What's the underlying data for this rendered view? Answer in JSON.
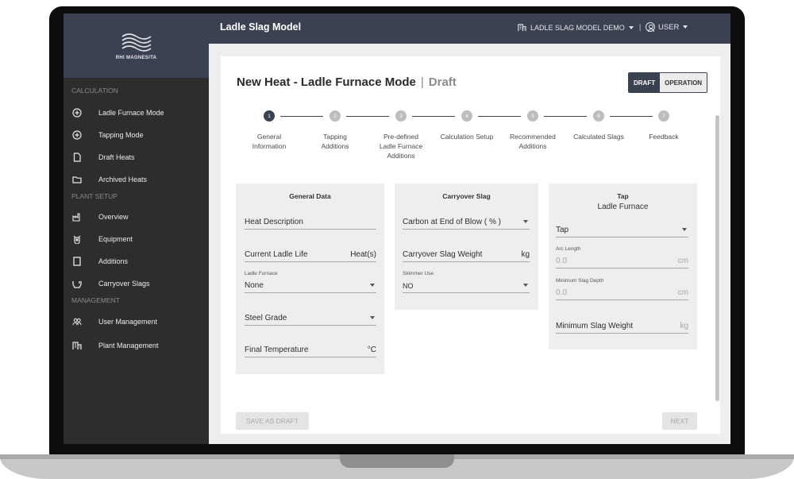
{
  "brand": {
    "name": "RHI MAGNESITA"
  },
  "header": {
    "app_title": "Ladle Slag Model",
    "tenant": "LADLE SLAG MODEL DEMO",
    "separator": "|",
    "user": "USER"
  },
  "sidebar": {
    "sections": [
      {
        "label": "CALCULATION",
        "items": [
          {
            "label": "Ladle Furnace Mode",
            "icon": "plus-circle-icon"
          },
          {
            "label": "Tapping Mode",
            "icon": "plus-circle-icon"
          },
          {
            "label": "Draft Heats",
            "icon": "file-icon"
          },
          {
            "label": "Archived Heats",
            "icon": "folder-icon"
          }
        ]
      },
      {
        "label": "PLANT SETUP",
        "items": [
          {
            "label": "Overview",
            "icon": "factory-icon"
          },
          {
            "label": "Equipment",
            "icon": "equipment-icon"
          },
          {
            "label": "Additions",
            "icon": "square-icon"
          },
          {
            "label": "Carryover Slags",
            "icon": "ladle-icon"
          }
        ]
      },
      {
        "label": "MANAGEMENT",
        "items": [
          {
            "label": "User Management",
            "icon": "users-icon"
          },
          {
            "label": "Plant Management",
            "icon": "building-icon"
          }
        ]
      }
    ]
  },
  "page": {
    "title": "New Heat - Ladle Furnace Mode",
    "separator": "|",
    "status": "Draft",
    "mode_toggle": {
      "draft": "DRAFT",
      "operation": "OPERATION",
      "active": "draft"
    }
  },
  "stepper": {
    "current": 1,
    "steps": [
      {
        "number": "1",
        "label_lines": [
          "General",
          "Information"
        ]
      },
      {
        "number": "2",
        "label_lines": [
          "Tapping",
          "Additions"
        ]
      },
      {
        "number": "3",
        "label_lines": [
          "Pre-defined",
          "Ladle Furnace",
          "Additions"
        ]
      },
      {
        "number": "4",
        "label_lines": [
          "Calculation Setup"
        ]
      },
      {
        "number": "5",
        "label_lines": [
          "Recommended",
          "Additions"
        ]
      },
      {
        "number": "6",
        "label_lines": [
          "Calculated Slags"
        ]
      },
      {
        "number": "7",
        "label_lines": [
          "Feedback"
        ]
      }
    ]
  },
  "general_data": {
    "title": "General Data",
    "heat_description": {
      "label": "Heat Description"
    },
    "current_ladle_life": {
      "label": "Current Ladle Life",
      "unit": "Heat(s)"
    },
    "ladle_furnace": {
      "caption": "Ladle Furnace",
      "value": "None"
    },
    "steel_grade": {
      "label": "Steel Grade"
    },
    "final_temperature": {
      "label": "Final Temperature",
      "unit": "°C"
    }
  },
  "carryover_slag": {
    "title": "Carryover Slag",
    "carbon_end_of_blow": {
      "label": "Carbon at End of Blow ( % )"
    },
    "carryover_slag_weight": {
      "label": "Carryover Slag Weight",
      "unit": "kg"
    },
    "skimmer_use": {
      "caption": "Skimmer Use",
      "value": "NO"
    }
  },
  "tap": {
    "title": "Tap",
    "subtitle": "Ladle Furnace",
    "tap_select": {
      "value": "Tap"
    },
    "arc_length": {
      "caption": "Arc Length",
      "value": "0.0",
      "unit": "cm"
    },
    "min_slag_depth": {
      "caption": "Minimum Slag Depth",
      "value": "0.0",
      "unit": "cm"
    },
    "min_slag_weight": {
      "label": "Minimum Slag Weight",
      "unit": "kg"
    }
  },
  "footer": {
    "save_as_draft": "SAVE AS DRAFT",
    "next": "NEXT"
  },
  "colors": {
    "header_bg": "#3a4252",
    "sidebar_bg": "#2d2d2d",
    "step_active": "#3a4252",
    "step_inactive": "#bdbdbd"
  }
}
